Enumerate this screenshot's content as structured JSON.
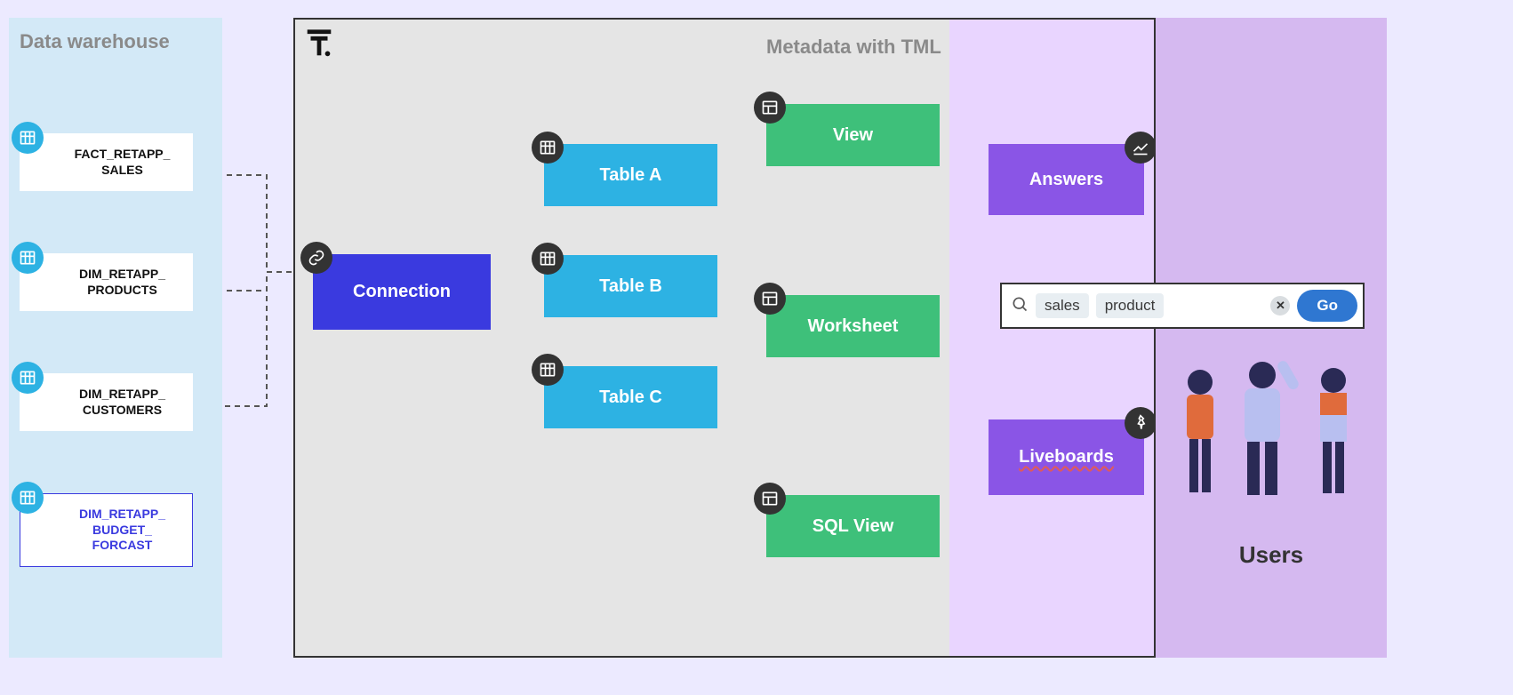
{
  "data_warehouse": {
    "title": "Data warehouse",
    "tables": [
      {
        "name": "FACT_RETAPP_\nSALES",
        "highlight": false
      },
      {
        "name": "DIM_RETAPP_\nPRODUCTS",
        "highlight": false
      },
      {
        "name": "DIM_RETAPP_\nCUSTOMERS",
        "highlight": false
      },
      {
        "name": "DIM_RETAPP_\nBUDGET_\nFORCAST",
        "highlight": true
      }
    ]
  },
  "tml": {
    "title": "Metadata with TML",
    "nodes": {
      "connection": "Connection",
      "table_a": "Table A",
      "table_b": "Table B",
      "table_c": "Table C",
      "view": "View",
      "worksheet": "Worksheet",
      "sql_view": "SQL View",
      "answers": "Answers",
      "liveboards": "Liveboards"
    }
  },
  "users": {
    "title": "Users"
  },
  "search": {
    "chip1": "sales",
    "chip2": "product",
    "go_label": "Go"
  }
}
